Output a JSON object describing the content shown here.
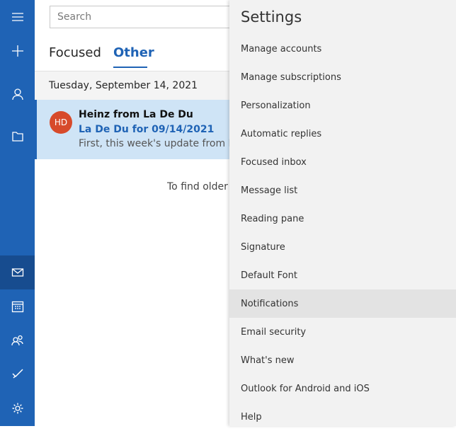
{
  "nav": {
    "items": [
      {
        "name": "hamburger-menu-icon"
      },
      {
        "name": "new-mail-icon"
      },
      {
        "name": "accounts-icon"
      },
      {
        "name": "folders-icon"
      },
      {
        "name": "mail-icon",
        "active": true
      },
      {
        "name": "calendar-icon"
      },
      {
        "name": "people-icon"
      },
      {
        "name": "todo-icon"
      },
      {
        "name": "settings-icon"
      }
    ],
    "colors": {
      "rail": "#1f63b5",
      "active": "#174c8f"
    }
  },
  "search": {
    "placeholder": "Search"
  },
  "tabs": {
    "focused": "Focused",
    "other": "Other"
  },
  "date_header": "Tuesday, September 14, 2021",
  "message": {
    "initials": "HD",
    "sender": "Heinz from La De Du",
    "subject": "La De Du for 09/14/2021",
    "preview": "First, this week's update from La"
  },
  "older_text": "To find older r",
  "settings": {
    "title": "Settings",
    "items": [
      "Manage accounts",
      "Manage subscriptions",
      "Personalization",
      "Automatic replies",
      "Focused inbox",
      "Message list",
      "Reading pane",
      "Signature",
      "Default Font",
      "Notifications",
      "Email security",
      "What's new",
      "Outlook for Android and iOS",
      "Help"
    ],
    "highlighted": "Notifications"
  }
}
